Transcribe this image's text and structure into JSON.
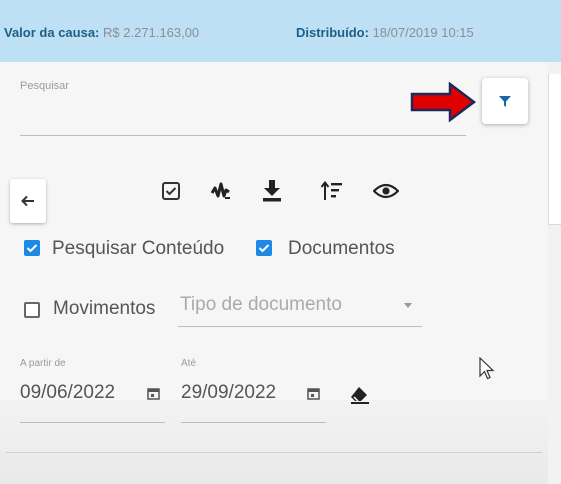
{
  "case_info": {
    "value_label": "Valor da causa:",
    "value": "R$ 2.271.163,00",
    "distributed_label": "Distribuído:",
    "distributed": "18/07/2019 10:15"
  },
  "search": {
    "label": "Pesquisar",
    "value": ""
  },
  "filter_button": {
    "icon": "filter-icon"
  },
  "toolbar": {
    "back_icon": "arrow-left-icon",
    "icons": [
      "checkbox-icon",
      "signature-icon",
      "download-icon",
      "sort-icon",
      "eye-icon"
    ]
  },
  "options": {
    "search_content": {
      "label": "Pesquisar Conteúdo",
      "checked": true
    },
    "documents": {
      "label": "Documentos",
      "checked": true
    },
    "movements": {
      "label": "Movimentos",
      "checked": false
    }
  },
  "doc_type": {
    "placeholder": "Tipo de documento",
    "value": ""
  },
  "dates": {
    "from_label": "A partir de",
    "from_value": "09/06/2022",
    "to_label": "Até",
    "to_value": "29/09/2022"
  },
  "colors": {
    "accent": "#1e88e5",
    "header_bg": "#bde0f4",
    "filter_icon": "#1565a8",
    "arrow": "#e00000"
  }
}
